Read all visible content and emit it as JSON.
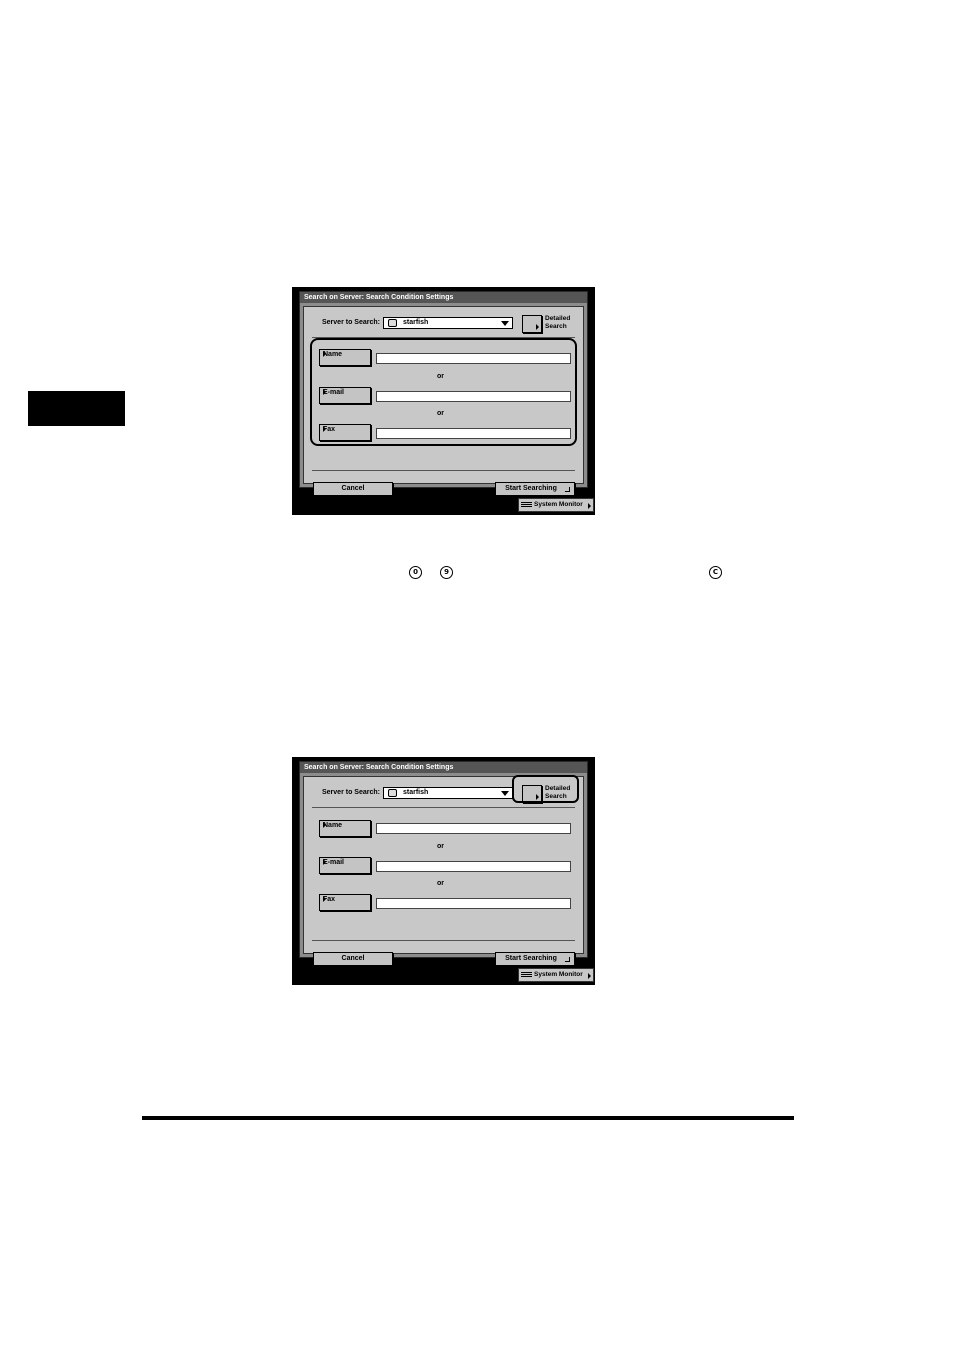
{
  "keys": [
    "0",
    "9",
    "C"
  ],
  "screens": [
    {
      "title": "Search on Server: Search Condition Settings",
      "server_label": "Server to Search:",
      "server_value": "starfish",
      "detailed_search_line1": "Detailed",
      "detailed_search_line2": "Search",
      "fields": [
        {
          "label": "Name",
          "value": ""
        },
        {
          "label": "E-mail",
          "value": ""
        },
        {
          "label": "Fax",
          "value": ""
        }
      ],
      "or_text": "or",
      "cancel_label": "Cancel",
      "start_label": "Start Searching",
      "system_monitor_label": "System Monitor",
      "highlight": "fields"
    },
    {
      "title": "Search on Server: Search Condition Settings",
      "server_label": "Server to Search:",
      "server_value": "starfish",
      "detailed_search_line1": "Detailed",
      "detailed_search_line2": "Search",
      "fields": [
        {
          "label": "Name",
          "value": ""
        },
        {
          "label": "E-mail",
          "value": ""
        },
        {
          "label": "Fax",
          "value": ""
        }
      ],
      "or_text": "or",
      "cancel_label": "Cancel",
      "start_label": "Start Searching",
      "system_monitor_label": "System Monitor",
      "highlight": "detailed-search"
    }
  ]
}
